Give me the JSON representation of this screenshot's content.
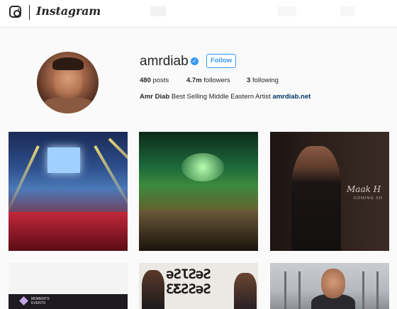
{
  "nav": {
    "brand": "Instagram",
    "camera_icon": "camera-icon"
  },
  "profile": {
    "username": "amrdiab",
    "verified": true,
    "follow_label": "Follow",
    "stats": {
      "posts_count": "480",
      "posts_label": "posts",
      "followers_count": "4.7m",
      "followers_label": "followers",
      "following_count": "3",
      "following_label": "following"
    },
    "bio": {
      "name": "Amr Diab",
      "text": "Best Selling Middle Eastern Artist",
      "link": "amrdiab.net"
    }
  },
  "grid": {
    "tile3_script": "Maak H",
    "tile3_caption": "COMING SO",
    "tile4_brand": "MOMENTS",
    "tile4_brand_sub": "EVENTS"
  },
  "colors": {
    "accent": "#3897f0",
    "link": "#003569",
    "text": "#262626",
    "background": "#fafafa"
  }
}
